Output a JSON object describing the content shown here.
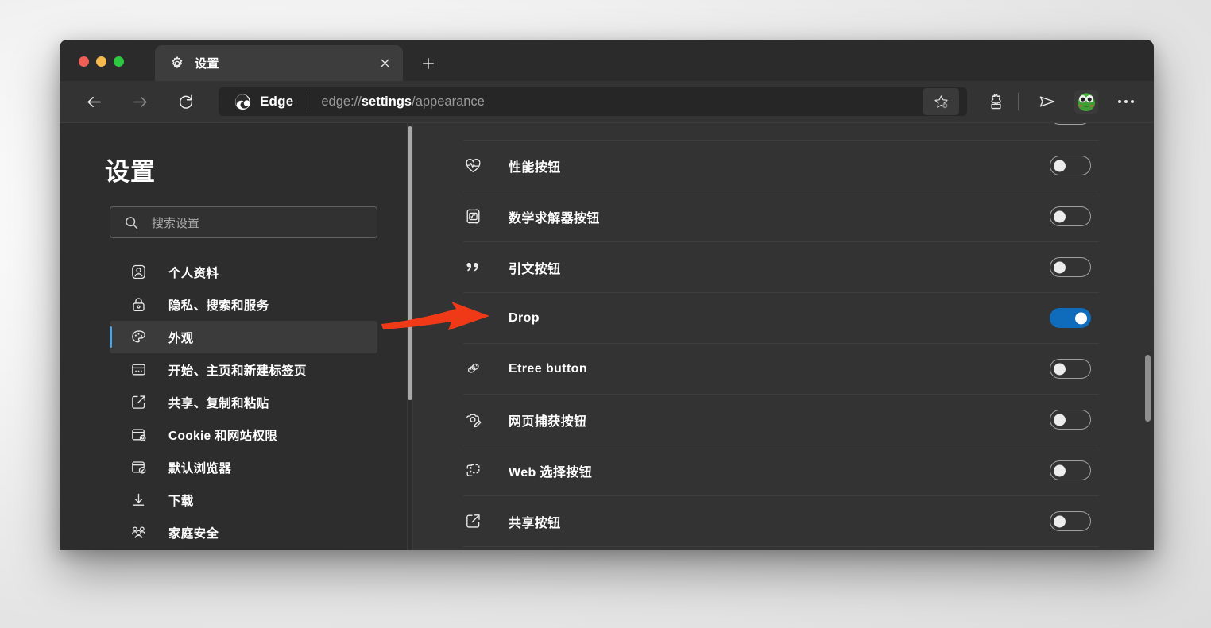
{
  "window": {
    "traffic_lights": [
      "close",
      "minimize",
      "maximize"
    ],
    "colors": {
      "accent_blue": "#0f6cbd",
      "sidebar_selected_bar": "#4ea3e0",
      "annotation_red": "#f03a17",
      "window_bg": "#333333",
      "page_bg": "#2d2d2d"
    }
  },
  "tab": {
    "title": "设置",
    "icon": "gear-icon",
    "close_label": "×",
    "new_tab_label": "+"
  },
  "toolbar": {
    "back_label": "←",
    "forward_label": "→",
    "reload_label": "⟳",
    "brand_name": "Edge",
    "url_prefix": "edge://",
    "url_bold": "settings",
    "url_suffix": "/appearance",
    "url_full": "edge://settings/appearance",
    "favorite_icon": "star-add-icon",
    "extensions_icon": "puzzle-icon",
    "drop_icon": "drop-send-icon",
    "avatar_icon": "frog-avatar",
    "more_icon": "ellipsis-icon"
  },
  "sidebar": {
    "title": "设置",
    "search": {
      "placeholder": "搜索设置",
      "value": "",
      "icon": "search-icon"
    },
    "items": [
      {
        "label": "个人资料",
        "icon": "profile-icon",
        "active": false
      },
      {
        "label": "隐私、搜索和服务",
        "icon": "lock-icon",
        "active": false
      },
      {
        "label": "外观",
        "icon": "palette-icon",
        "active": true
      },
      {
        "label": "开始、主页和新建标签页",
        "icon": "home-page-icon",
        "active": false
      },
      {
        "label": "共享、复制和粘贴",
        "icon": "share-copy-icon",
        "active": false
      },
      {
        "label": "Cookie 和网站权限",
        "icon": "cookie-permissions-icon",
        "active": false
      },
      {
        "label": "默认浏览器",
        "icon": "default-browser-icon",
        "active": false
      },
      {
        "label": "下载",
        "icon": "download-icon",
        "active": false
      },
      {
        "label": "家庭安全",
        "icon": "family-safety-icon",
        "active": false
      }
    ]
  },
  "content": {
    "rows": [
      {
        "label": "",
        "icon": "partial-row-icon",
        "toggle": "off",
        "partial": true
      },
      {
        "label": "性能按钮",
        "icon": "performance-icon",
        "toggle": "off"
      },
      {
        "label": "数学求解器按钮",
        "icon": "math-solver-icon",
        "toggle": "off"
      },
      {
        "label": "引文按钮",
        "icon": "citation-quote-icon",
        "toggle": "off"
      },
      {
        "label": "Drop",
        "icon": "drop-send-icon",
        "toggle": "on"
      },
      {
        "label": "Etree button",
        "icon": "etree-icon",
        "toggle": "off"
      },
      {
        "label": "网页捕获按钮",
        "icon": "web-capture-camera-icon",
        "toggle": "off"
      },
      {
        "label": "Web 选择按钮",
        "icon": "web-select-icon",
        "toggle": "off"
      },
      {
        "label": "共享按钮",
        "icon": "share-icon",
        "toggle": "off"
      }
    ]
  },
  "annotation": {
    "arrow": "red-arrow-pointing-right",
    "points_at": "Drop"
  }
}
